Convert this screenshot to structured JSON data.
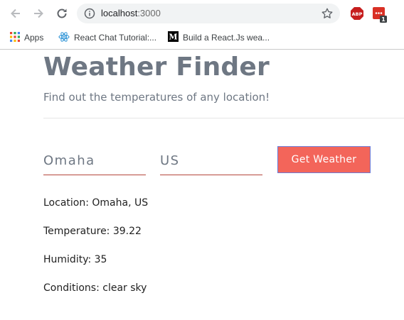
{
  "browser": {
    "url_host": "localhost",
    "url_port": ":3000",
    "abp_label": "ABP",
    "extension_badge": "1",
    "bookmarks": [
      {
        "label": "Apps"
      },
      {
        "label": "React Chat Tutorial:..."
      },
      {
        "label": "Build a React.Js wea..."
      }
    ]
  },
  "app": {
    "title": "Weather Finder",
    "subtitle": "Find out the temperatures of any location!"
  },
  "form": {
    "city_value": "Omaha",
    "country_value": "US",
    "submit_label": "Get Weather"
  },
  "results": {
    "location": "Location: Omaha, US",
    "temperature": "Temperature: 39.22",
    "humidity": "Humidity: 35",
    "conditions": "Conditions: clear sky"
  },
  "colors": {
    "accent_button": "#f3655a",
    "button_border": "#6c7bd6",
    "title_gray": "#6e7783",
    "input_underline": "#b5463c"
  }
}
